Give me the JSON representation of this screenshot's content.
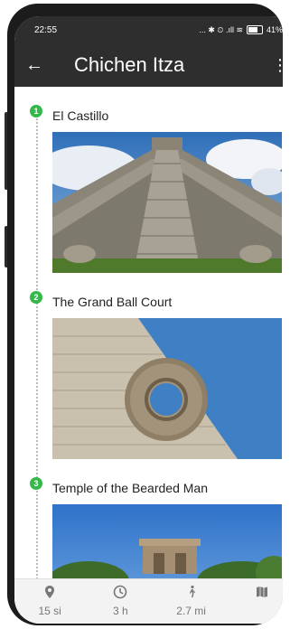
{
  "status": {
    "time": "22:55",
    "icons_text": "... ✱ ⏲ .ıll ≋",
    "battery": "41%"
  },
  "appbar": {
    "title": "Chichen Itza"
  },
  "stops": [
    {
      "number": "1",
      "name": "El Castillo"
    },
    {
      "number": "2",
      "name": "The Grand Ball Court"
    },
    {
      "number": "3",
      "name": "Temple of the Bearded Man"
    }
  ],
  "bottom_nav": [
    {
      "icon": "location-pin-icon",
      "label": "15 si"
    },
    {
      "icon": "clock-icon",
      "label": "3 h"
    },
    {
      "icon": "walking-icon",
      "label": "2.7 mi"
    },
    {
      "icon": "map-icon",
      "label": ""
    }
  ],
  "colors": {
    "appbar": "#2e2e2e",
    "badge": "#35b84a"
  }
}
